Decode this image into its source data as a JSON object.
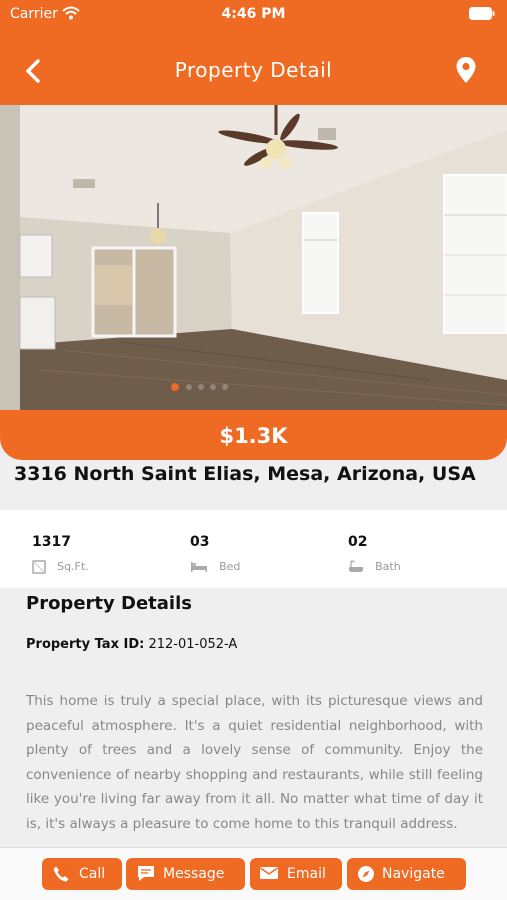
{
  "status_bar": {
    "carrier": "Carrier",
    "time": "4:46 PM"
  },
  "nav": {
    "title": "Property Detail"
  },
  "gallery": {
    "slide_count": 5,
    "active_slide": 1
  },
  "listing": {
    "price": "$1.3K",
    "address": "3316 North Saint Elias, Mesa, Arizona, USA"
  },
  "stats": {
    "sqft": {
      "value": "1317",
      "label": "Sq.Ft."
    },
    "bed": {
      "value": "03",
      "label": "Bed"
    },
    "bath": {
      "value": "02",
      "label": "Bath"
    }
  },
  "details": {
    "heading": "Property Details",
    "tax_label": "Property Tax ID:",
    "tax_value": "212-01-052-A",
    "description": "This home is truly a special place, with its picturesque views and peaceful atmosphere. It's a quiet residential neighborhood, with plenty of trees and a lovely sense of community. Enjoy the convenience of nearby shopping and restaurants, while still feeling like you're living far away from it all. No matter what time of day it is, it's always a pleasure to come home to this tranquil address."
  },
  "actions": {
    "call": "Call",
    "message": "Message",
    "email": "Email",
    "navigate": "Navigate"
  },
  "colors": {
    "accent": "#ef6a22",
    "background": "#efefef",
    "muted_text": "#888888"
  },
  "icons": {
    "back": "back-chevron-icon",
    "location": "location-pin-icon",
    "sqft": "area-icon",
    "bed": "bed-icon",
    "bath": "bathtub-icon",
    "call": "phone-icon",
    "message": "chat-bubble-icon",
    "email": "envelope-icon",
    "navigate": "compass-icon"
  }
}
